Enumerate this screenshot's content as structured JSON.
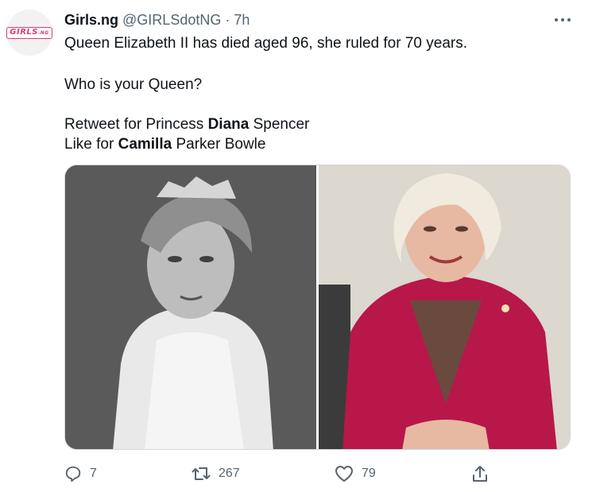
{
  "tweet": {
    "author_name": "Girls.ng",
    "author_handle": "@GIRLSdotNG",
    "separator": "·",
    "time": "7h",
    "avatar_text": "GIRLS",
    "avatar_suffix": ".NG",
    "line1": "Queen Elizabeth II has died aged 96, she ruled for 70 years.",
    "line2": "Who is your Queen?",
    "line3_pre": "Retweet for Princess ",
    "line3_bold": "Diana",
    "line3_post": " Spencer",
    "line4_pre": "Like for ",
    "line4_bold": "Camilla",
    "line4_post": " Parker Bowle"
  },
  "media": {
    "left_photo": "portrait of woman wearing a tiara, black and white",
    "right_photo": "portrait of smiling woman in a red jacket"
  },
  "actions": {
    "reply_count": "7",
    "retweet_count": "267",
    "like_count": "79"
  },
  "icons": {
    "reply": "reply-icon",
    "retweet": "retweet-icon",
    "like": "heart-icon",
    "share": "share-icon",
    "more": "more-icon"
  },
  "colors": {
    "text": "#0f1419",
    "muted": "#536471",
    "border": "#cfd9de",
    "brand": "#e2396b"
  }
}
